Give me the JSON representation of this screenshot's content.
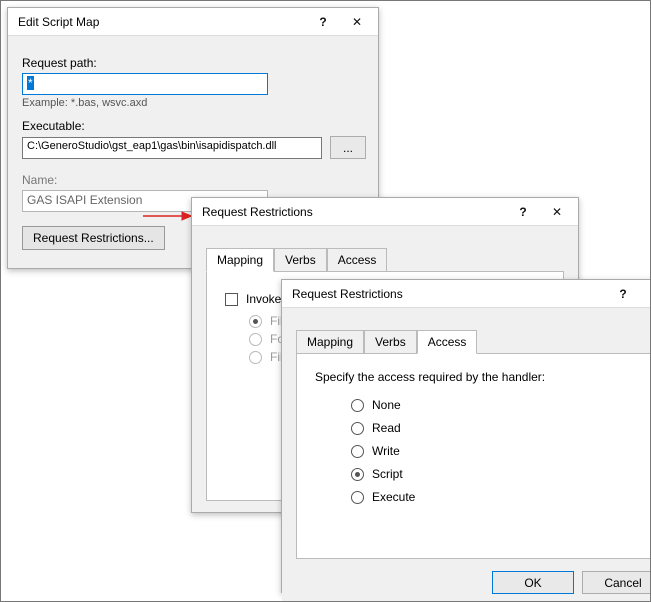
{
  "edit": {
    "title": "Edit Script Map",
    "requestPathLabel": "Request path:",
    "requestPathValue": "*",
    "requestPathHint": "Example: *.bas, wsvc.axd",
    "executableLabel": "Executable:",
    "executableValue": "C:\\GeneroStudio\\gst_eap1\\gas\\bin\\isapidispatch.dll",
    "browseLabel": "...",
    "nameLabel": "Name:",
    "nameValue": "GAS ISAPI Extension",
    "restrictionsBtn": "Request Restrictions..."
  },
  "rr1": {
    "title": "Request Restrictions",
    "tabs": {
      "mapping": "Mapping",
      "verbs": "Verbs",
      "access": "Access"
    },
    "invoke": "Invoke handler only if request is mapped to:",
    "file": "File",
    "folder": "Folder",
    "fileorfolder": "File or folder"
  },
  "rr2": {
    "title": "Request Restrictions",
    "tabs": {
      "mapping": "Mapping",
      "verbs": "Verbs",
      "access": "Access"
    },
    "prompt": "Specify the access required by the handler:",
    "none": "None",
    "read": "Read",
    "write": "Write",
    "script": "Script",
    "execute": "Execute",
    "ok": "OK",
    "cancel": "Cancel"
  },
  "glyph": {
    "help": "?",
    "close": "✕"
  }
}
